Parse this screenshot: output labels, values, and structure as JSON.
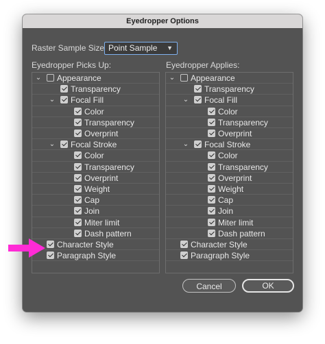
{
  "dialog": {
    "title": "Eyedropper Options"
  },
  "raster": {
    "label": "Raster Sample Size:",
    "value": "Point Sample"
  },
  "picks": {
    "heading": "Eyedropper Picks Up:",
    "items": [
      {
        "label": "Appearance",
        "checked": false,
        "level": 0,
        "disclosure": "open"
      },
      {
        "label": "Transparency",
        "checked": true,
        "level": 1
      },
      {
        "label": "Focal Fill",
        "checked": true,
        "level": 1,
        "disclosure": "open"
      },
      {
        "label": "Color",
        "checked": true,
        "level": 2
      },
      {
        "label": "Transparency",
        "checked": true,
        "level": 2
      },
      {
        "label": "Overprint",
        "checked": true,
        "level": 2
      },
      {
        "label": "Focal Stroke",
        "checked": true,
        "level": 1,
        "disclosure": "open"
      },
      {
        "label": "Color",
        "checked": true,
        "level": 2
      },
      {
        "label": "Transparency",
        "checked": true,
        "level": 2
      },
      {
        "label": "Overprint",
        "checked": true,
        "level": 2
      },
      {
        "label": "Weight",
        "checked": true,
        "level": 2
      },
      {
        "label": "Cap",
        "checked": true,
        "level": 2
      },
      {
        "label": "Join",
        "checked": true,
        "level": 2
      },
      {
        "label": "Miter limit",
        "checked": true,
        "level": 2
      },
      {
        "label": "Dash pattern",
        "checked": true,
        "level": 2
      },
      {
        "label": "Character Style",
        "checked": true,
        "level": 0
      },
      {
        "label": "Paragraph Style",
        "checked": true,
        "level": 0
      }
    ]
  },
  "applies": {
    "heading": "Eyedropper Applies:",
    "items": [
      {
        "label": "Appearance",
        "checked": false,
        "level": 0,
        "disclosure": "open"
      },
      {
        "label": "Transparency",
        "checked": true,
        "level": 1
      },
      {
        "label": "Focal Fill",
        "checked": true,
        "level": 1,
        "disclosure": "open"
      },
      {
        "label": "Color",
        "checked": true,
        "level": 2
      },
      {
        "label": "Transparency",
        "checked": true,
        "level": 2
      },
      {
        "label": "Overprint",
        "checked": true,
        "level": 2
      },
      {
        "label": "Focal Stroke",
        "checked": true,
        "level": 1,
        "disclosure": "open"
      },
      {
        "label": "Color",
        "checked": true,
        "level": 2
      },
      {
        "label": "Transparency",
        "checked": true,
        "level": 2
      },
      {
        "label": "Overprint",
        "checked": true,
        "level": 2
      },
      {
        "label": "Weight",
        "checked": true,
        "level": 2
      },
      {
        "label": "Cap",
        "checked": true,
        "level": 2
      },
      {
        "label": "Join",
        "checked": true,
        "level": 2
      },
      {
        "label": "Miter limit",
        "checked": true,
        "level": 2
      },
      {
        "label": "Dash pattern",
        "checked": true,
        "level": 2
      },
      {
        "label": "Character Style",
        "checked": true,
        "level": 0
      },
      {
        "label": "Paragraph Style",
        "checked": true,
        "level": 0
      }
    ]
  },
  "buttons": {
    "cancel": "Cancel",
    "ok": "OK"
  },
  "annotation": {
    "icon": "pointer-arrow-icon",
    "color": "#ff2bd6"
  }
}
